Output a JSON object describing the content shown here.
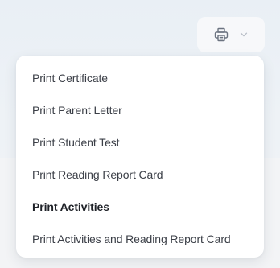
{
  "print_button": {
    "icon": "printer-icon",
    "chevron": "chevron-down-icon",
    "icon_color": "#6b7380",
    "chevron_color": "#b8bec7"
  },
  "print_menu": {
    "items": [
      {
        "label": "Print Certificate"
      },
      {
        "label": "Print Parent Letter"
      },
      {
        "label": "Print Student Test"
      },
      {
        "label": "Print Reading Report Card"
      },
      {
        "label": "Print Activities",
        "active": true
      },
      {
        "label": "Print Activities and Reading Report Card"
      }
    ]
  }
}
